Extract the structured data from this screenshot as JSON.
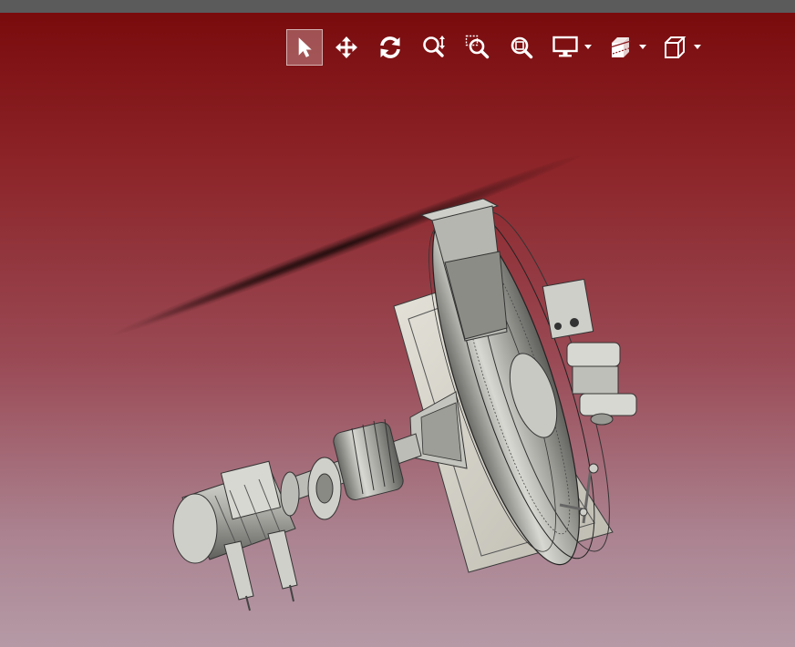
{
  "window": {
    "top_strip_color": "#5b5b5b"
  },
  "viewport": {
    "background_top": "#7a0b0d",
    "background_bottom": "#b59aa6"
  },
  "toolbar": {
    "tools": [
      {
        "id": "select",
        "icon": "arrow-pointer-icon",
        "active": true
      },
      {
        "id": "pan",
        "icon": "pan-arrows-icon",
        "active": false
      },
      {
        "id": "rotate",
        "icon": "rotate-icon",
        "active": false
      },
      {
        "id": "zoom",
        "icon": "zoom-updown-icon",
        "active": false
      },
      {
        "id": "zoom-window",
        "icon": "zoom-window-icon",
        "active": false
      },
      {
        "id": "zoom-fit",
        "icon": "zoom-fit-icon",
        "active": false
      }
    ],
    "dropdowns": [
      {
        "id": "display-mode",
        "icon": "monitor-icon",
        "arrow_icon": "caret-down-icon"
      },
      {
        "id": "sectioning",
        "icon": "section-cube-icon",
        "arrow_icon": "caret-down-icon"
      },
      {
        "id": "view-orientation",
        "icon": "view-cube-icon",
        "arrow_icon": "caret-down-icon"
      }
    ]
  },
  "model": {
    "icon": "cad-assembly-model",
    "colors": {
      "metal_light": "#d9d9d4",
      "metal_mid": "#a8a8a2",
      "metal_dark": "#6f6f6a",
      "edge": "#2a2a2a"
    }
  }
}
